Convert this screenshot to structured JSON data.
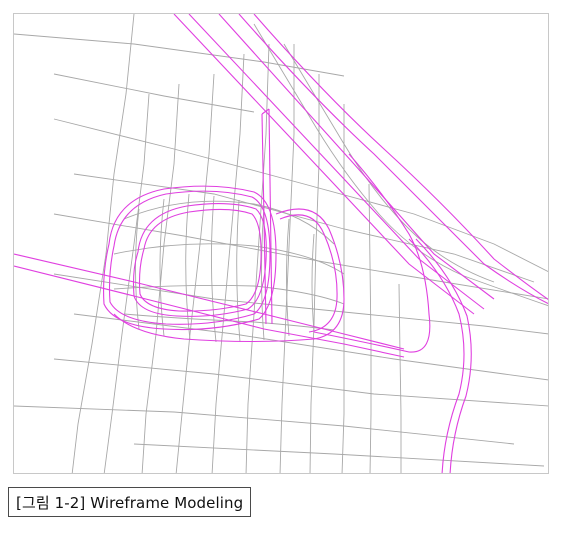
{
  "figure": {
    "caption": "[그림 1-2] Wireframe Modeling",
    "colors": {
      "grid_lines": "#a8a8a8",
      "feature_curves": "#e040e0",
      "frame_border": "#c8c8c8",
      "caption_border": "#4a4a4a"
    }
  }
}
